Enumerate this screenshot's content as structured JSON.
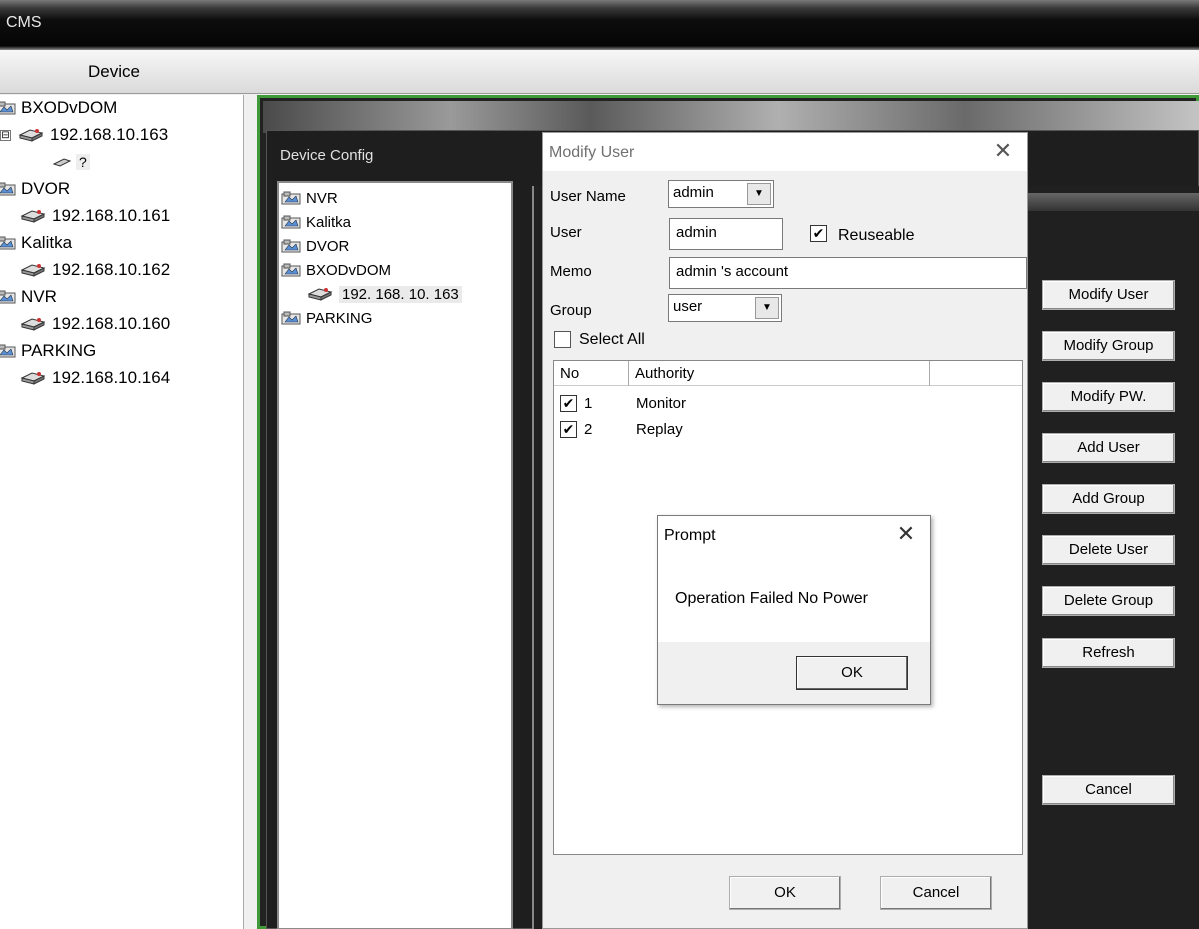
{
  "app": {
    "title": "CMS",
    "device_tab": "Device"
  },
  "left_tree": [
    {
      "type": "group",
      "label": "BXODvDOM"
    },
    {
      "type": "device",
      "label": "192.168.10.163",
      "expanded": true
    },
    {
      "type": "channel",
      "label": "?"
    },
    {
      "type": "group",
      "label": "DVOR"
    },
    {
      "type": "device",
      "label": "192.168.10.161"
    },
    {
      "type": "group",
      "label": "Kalitka"
    },
    {
      "type": "device",
      "label": "192.168.10.162"
    },
    {
      "type": "group",
      "label": "NVR"
    },
    {
      "type": "device",
      "label": "192.168.10.160"
    },
    {
      "type": "group",
      "label": "PARKING"
    },
    {
      "type": "device",
      "label": "192.168.10.164"
    }
  ],
  "device_config": {
    "title": "Device Config",
    "tree": [
      {
        "type": "group",
        "label": "NVR"
      },
      {
        "type": "group",
        "label": "Kalitka"
      },
      {
        "type": "group",
        "label": "DVOR"
      },
      {
        "type": "group",
        "label": "BXODvDOM"
      },
      {
        "type": "device",
        "label": "192. 168. 10. 163",
        "selected": true
      },
      {
        "type": "group",
        "label": "PARKING"
      }
    ],
    "buttons": {
      "modify_user": "Modify User",
      "modify_group": "Modify Group",
      "modify_pw": "Modify PW.",
      "add_user": "Add User",
      "add_group": "Add Group",
      "delete_user": "Delete User",
      "delete_group": "Delete Group",
      "refresh": "Refresh",
      "cancel": "Cancel"
    }
  },
  "modify_user": {
    "title": "Modify User",
    "close_glyph": "✕",
    "user_name_label": "User Name",
    "user_name_value": "admin",
    "user_label": "User",
    "user_value": "admin",
    "reuseable_label": "Reuseable",
    "reuseable_checked": true,
    "memo_label": "Memo",
    "memo_value": "admin 's account",
    "group_label": "Group",
    "group_value": "user",
    "select_all_label": "Select All",
    "columns": {
      "no": "No",
      "authority": "Authority"
    },
    "authorities": [
      {
        "no": "1",
        "name": "Monitor",
        "checked": true
      },
      {
        "no": "2",
        "name": "Replay",
        "checked": true
      }
    ],
    "ok_label": "OK",
    "cancel_label": "Cancel"
  },
  "prompt": {
    "title": "Prompt",
    "close_glyph": "✕",
    "message": "Operation Failed No Power",
    "ok_label": "OK"
  },
  "icons": {
    "check": "✔",
    "expander": "⊟",
    "dropdown": "▼"
  },
  "colors": {
    "video_border": "#3f9a3a",
    "window_dark": "#1e1e1e"
  }
}
